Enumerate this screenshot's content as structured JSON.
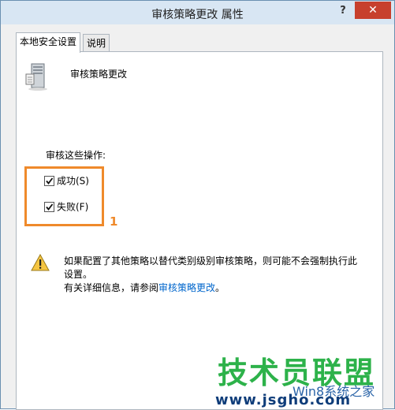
{
  "window": {
    "title": "审核策略更改 属性",
    "help_label": "?",
    "close_label": "✕"
  },
  "tabs": [
    {
      "label": "本地安全设置",
      "active": true
    },
    {
      "label": "说明",
      "active": false
    }
  ],
  "policy": {
    "icon": "server-policy-icon",
    "name": "审核策略更改"
  },
  "audit": {
    "label": "审核这些操作:",
    "options": [
      {
        "label": "成功(S)",
        "checked": true
      },
      {
        "label": "失败(F)",
        "checked": true
      }
    ]
  },
  "annotation": {
    "number": "1",
    "color": "#ef8a2b"
  },
  "warning": {
    "icon": "warning-icon",
    "line1": "如果配置了其他策略以替代类别级别审核策略，则可能不会强制执行此",
    "line2": "设置。",
    "line3_prefix": "有关详细信息，请参阅",
    "link_text": "审核策略更改",
    "line3_suffix": "。"
  },
  "watermark": {
    "logo_text": "技术员联盟",
    "subtitle": "Win8系统之家",
    "url": "www.jsgho.com"
  }
}
